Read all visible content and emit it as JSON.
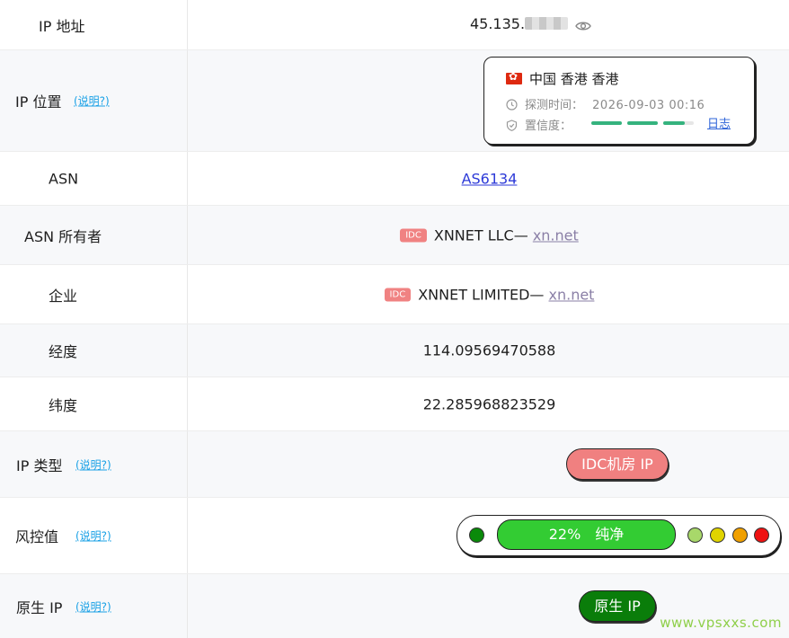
{
  "rows": {
    "ip": {
      "label": "IP 地址",
      "value_prefix": "45.135."
    },
    "location": {
      "label": "IP 位置",
      "help": "(说明?)",
      "place": "中国 香港 香港",
      "detect_label": "探测时间：",
      "detect_time": "2026-09-03 00:16",
      "confidence_label": "置信度：",
      "confidence_level": 0.9,
      "log_link": "日志"
    },
    "asn": {
      "label": "ASN",
      "value": "AS6134"
    },
    "asn_owner": {
      "label": "ASN 所有者",
      "badge": "IDC",
      "name": "XNNET LLC— ",
      "domain": "xn.net"
    },
    "company": {
      "label": "企业",
      "badge": "IDC",
      "name": "XNNET LIMITED— ",
      "domain": "xn.net"
    },
    "longitude": {
      "label": "经度",
      "value": "114.09569470588"
    },
    "latitude": {
      "label": "纬度",
      "value": "22.285968823529"
    },
    "ip_type": {
      "label": "IP 类型",
      "help": "(说明?)",
      "value": "IDC机房 IP",
      "color": "#f08080"
    },
    "risk": {
      "label": "风控值",
      "help": "(说明?)",
      "percent": "22%",
      "status": "纯净",
      "colors": {
        "start": "#0a8a0a",
        "bar": "#33cc33",
        "d1": "#a8d86a",
        "d2": "#e0d400",
        "d3": "#f0a000",
        "d4": "#ee1111"
      }
    },
    "native_ip": {
      "label": "原生 IP",
      "help": "(说明?)",
      "value": "原生 IP",
      "color": "#0a7d0a"
    }
  },
  "watermark": "www.vpsxxs.com"
}
